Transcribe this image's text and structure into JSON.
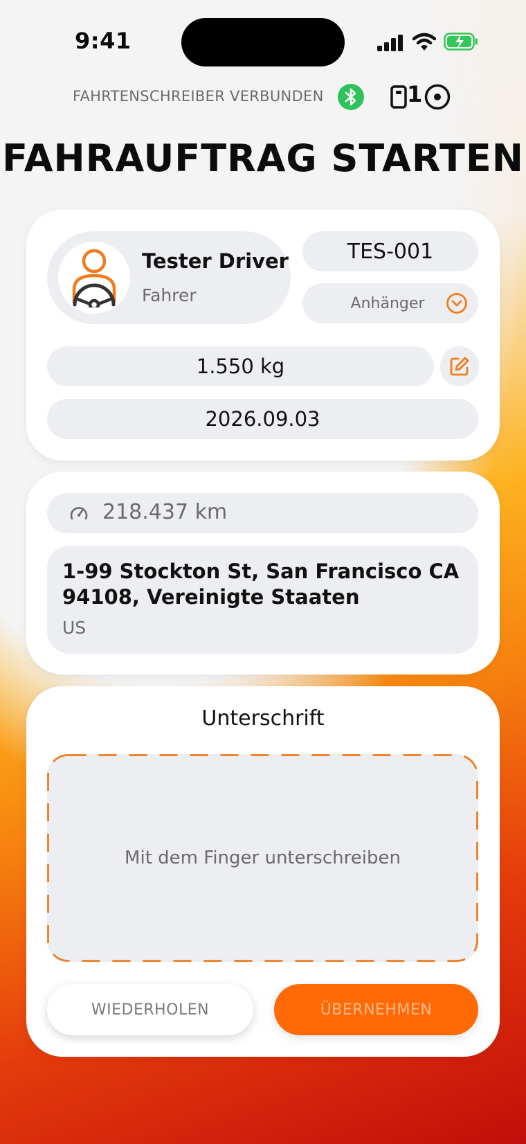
{
  "status_bar": {
    "time": "9:41"
  },
  "tacho": {
    "status_text": "FAHRTENSCHREIBER VERBUNDEN",
    "card_count": "1",
    "bt_color": "#2fc25b"
  },
  "page_title": "FAHRAUFTRAG STARTEN",
  "colors": {
    "accent": "#f07c1e",
    "primary_button": "#ff6a07"
  },
  "driver": {
    "name": "Tester Driver",
    "role": "Fahrer"
  },
  "vehicle": {
    "plate": "TES-001",
    "trailer_label": "Anhänger"
  },
  "cargo": {
    "weight": "1.550 kg",
    "date": "2026.09.03"
  },
  "trip": {
    "odometer": "218.437 km",
    "address_line1": "1-99 Stockton St, San Francisco CA",
    "address_line2": "94108, Vereinigte Staaten",
    "country": "US"
  },
  "signature": {
    "title": "Unterschrift",
    "hint": "Mit dem Finger unterschreiben",
    "repeat_label": "WIEDERHOLEN",
    "accept_label": "ÜBERNEHMEN"
  },
  "icons": [
    "signal-icon",
    "wifi-icon",
    "battery-charging-icon",
    "bluetooth-icon",
    "tachograph-card-icon",
    "target-icon",
    "driver-steering-icon",
    "chevron-down-circle-icon",
    "edit-icon",
    "speedometer-icon"
  ]
}
